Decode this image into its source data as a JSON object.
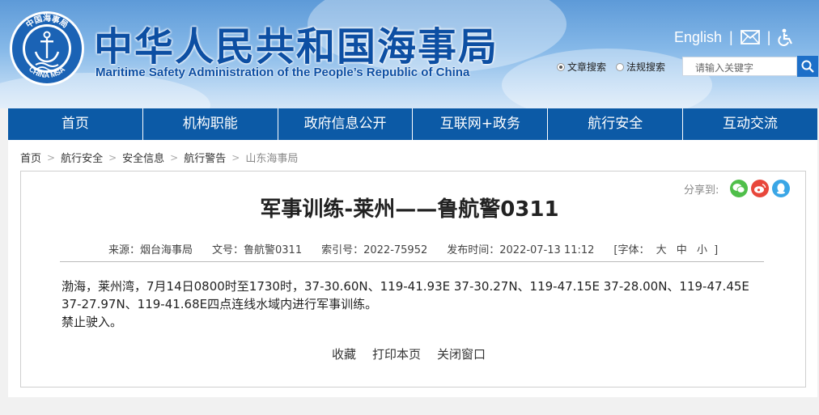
{
  "header": {
    "title_cn": "中华人民共和国海事局",
    "title_en": "Maritime Safety Administration of the People’s Republic of China",
    "emblem_text_top": "中国海事局",
    "emblem_text_bottom": "CHINA MSA",
    "english_link": "English",
    "separator": "|"
  },
  "search": {
    "options": [
      "文章搜索",
      "法规搜索"
    ],
    "placeholder": "请输入关键字"
  },
  "nav": {
    "items": [
      "首页",
      "机构职能",
      "政府信息公开",
      "互联网+政务",
      "航行安全",
      "互动交流"
    ]
  },
  "breadcrumb": {
    "items": [
      "首页",
      "航行安全",
      "安全信息",
      "航行警告",
      "山东海事局"
    ],
    "arrow": ">"
  },
  "share": {
    "label": "分享到:",
    "icons": [
      "wechat-icon",
      "weibo-icon",
      "qq-icon"
    ],
    "colors": {
      "wechat": "#4fbf4a",
      "weibo": "#e8473b",
      "qq": "#3aa6e6"
    }
  },
  "article": {
    "title": "军事训练-莱州——鲁航警0311",
    "meta": {
      "source": "来源：烟台海事局",
      "doc_no": "文号：鲁航警0311",
      "index_no": "索引号：2022-75952",
      "publish_time": "发布时间：2022-07-13 11:12",
      "font_label": "[字体：",
      "font_large": "大",
      "font_medium": "中",
      "font_small": "小",
      "font_close": "]"
    },
    "paragraphs": [
      "渤海，莱州湾，7月14日0800时至1730时，37-30.60N、119-41.93E 37-30.27N、119-47.15E 37-28.00N、119-47.45E 37-27.97N、119-41.68E四点连线水域内进行军事训练。",
      "禁止驶入。"
    ],
    "actions": [
      "收藏",
      "打印本页",
      "关闭窗口"
    ]
  },
  "colors": {
    "nav_bg": "#0c5aa6",
    "title_blue": "#0d4fa3",
    "search_btn": "#1d6fc8"
  }
}
